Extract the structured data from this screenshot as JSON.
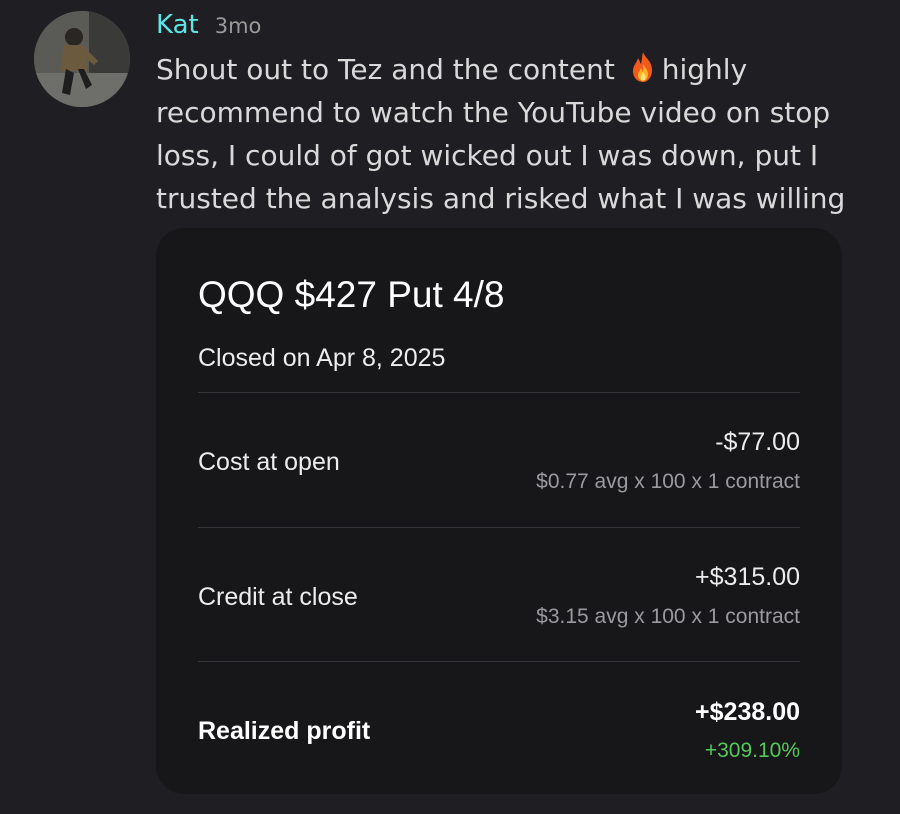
{
  "post": {
    "username": "Kat",
    "timestamp": "3mo",
    "message_part1": "Shout out to Tez and the content ",
    "message_emoji": "fire-icon",
    "message_part2": "highly recommend to watch the YouTube video on stop loss, I could of got wicked out I was down, put I trusted the analysis and risked what I was willing"
  },
  "card": {
    "title": "QQQ $427 Put 4/8",
    "subtitle": "Closed on Apr 8, 2025",
    "rows": [
      {
        "label": "Cost at open",
        "value": "-$77.00",
        "detail": "$0.77 avg x 100 x 1 contract"
      },
      {
        "label": "Credit at close",
        "value": "+$315.00",
        "detail": "$3.15 avg x 100 x 1 contract"
      },
      {
        "label": "Realized profit",
        "value": "+$238.00",
        "detail": "+309.10%"
      }
    ]
  },
  "colors": {
    "username": "#5ee6e6",
    "profit_green": "#52c95a",
    "background": "#1f1f23",
    "card_background": "#17171a"
  }
}
